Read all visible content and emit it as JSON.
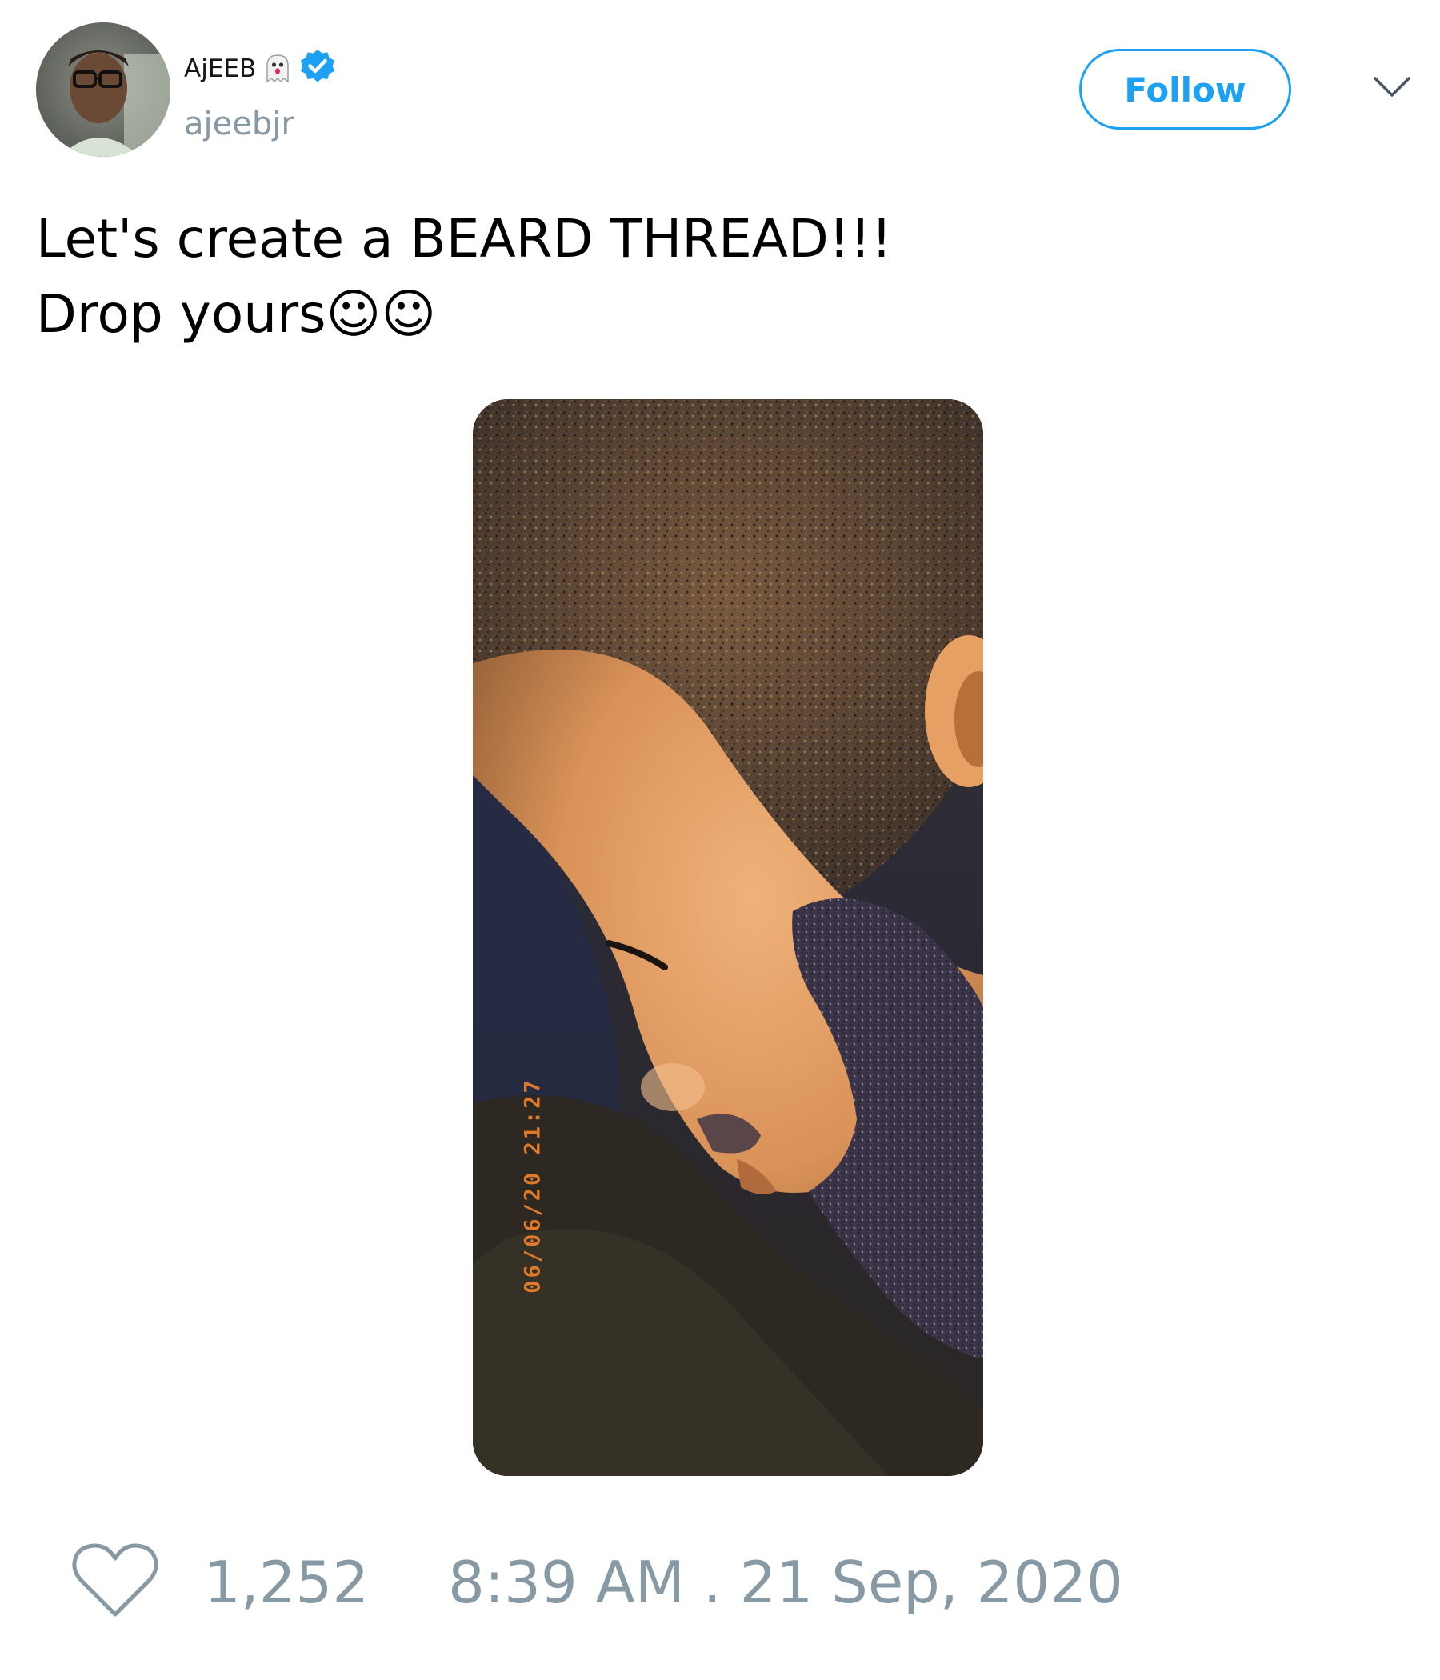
{
  "author": {
    "display_name": "AjEEB",
    "handle": "ajeebjr",
    "verified": true,
    "emoji_icon": "ghost-icon"
  },
  "header": {
    "follow_label": "Follow",
    "menu_icon": "chevron-down-icon"
  },
  "tweet": {
    "text_lines": [
      "Let's create a BEARD THREAD!!!",
      "Drop yours☺☺"
    ],
    "media": {
      "alt": "",
      "stamp": "06/06/20 21:27"
    }
  },
  "footer": {
    "like_icon": "heart-outline-icon",
    "like_count": "1,252",
    "timestamp": "8:39 AM . 21 Sep, 2020"
  },
  "colors": {
    "accent": "#1da1f2",
    "muted": "#8899a6",
    "text": "#000000",
    "stamp": "#e07a2a"
  }
}
